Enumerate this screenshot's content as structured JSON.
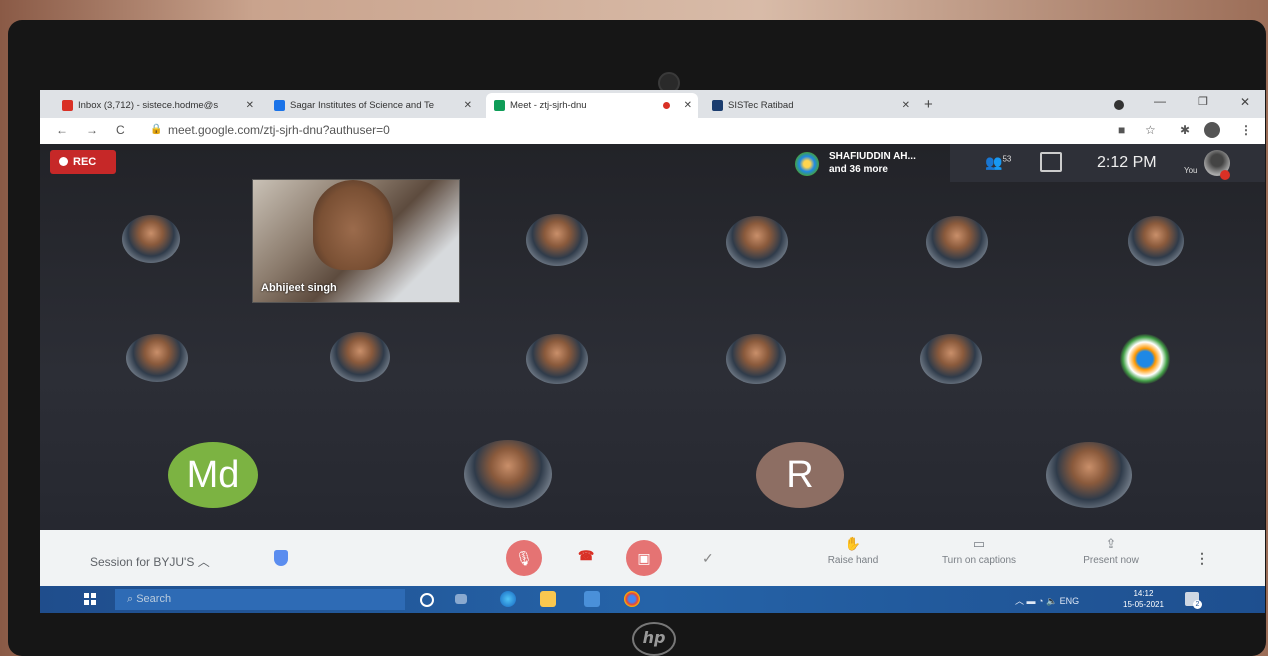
{
  "browser": {
    "tabs": [
      {
        "label": "Inbox (3,712) - sistece.hodme@s",
        "favicon_color": "#d93025",
        "active": false
      },
      {
        "label": "Sagar Institutes of Science and Te",
        "favicon_color": "#1a73e8",
        "active": false
      },
      {
        "label": "Meet - ztj-sjrh-dnu",
        "favicon_color": "#0f9d58",
        "active": true
      },
      {
        "label": "SISTec Ratibad",
        "favicon_color": "#1a3c6e",
        "active": false
      }
    ],
    "url": "meet.google.com/ztj-sjrh-dnu?authuser=0"
  },
  "meet": {
    "rec_label": "REC",
    "presenter_name": "SHAFIUDDIN AH...",
    "presenter_more": "and 36 more",
    "participant_count": "53",
    "clock": "2:12 PM",
    "you_label": "You",
    "featured_name": "Abhijeet singh",
    "letter_tiles": [
      {
        "text": "Md",
        "color": "#7cb342"
      },
      {
        "text": "R",
        "color": "#8d6e63"
      }
    ]
  },
  "controls": {
    "session_label": "Session for BYJU'S",
    "raise_hand": "Raise hand",
    "captions": "Turn on captions",
    "present": "Present now"
  },
  "taskbar": {
    "search_placeholder": "Search",
    "lang": "ENG",
    "time": "14:12",
    "date": "15-05-2021",
    "notif_count": "2"
  },
  "colors": {
    "rec": "#c62828",
    "mic_off": "#e57373",
    "hangup": "#d93025"
  }
}
